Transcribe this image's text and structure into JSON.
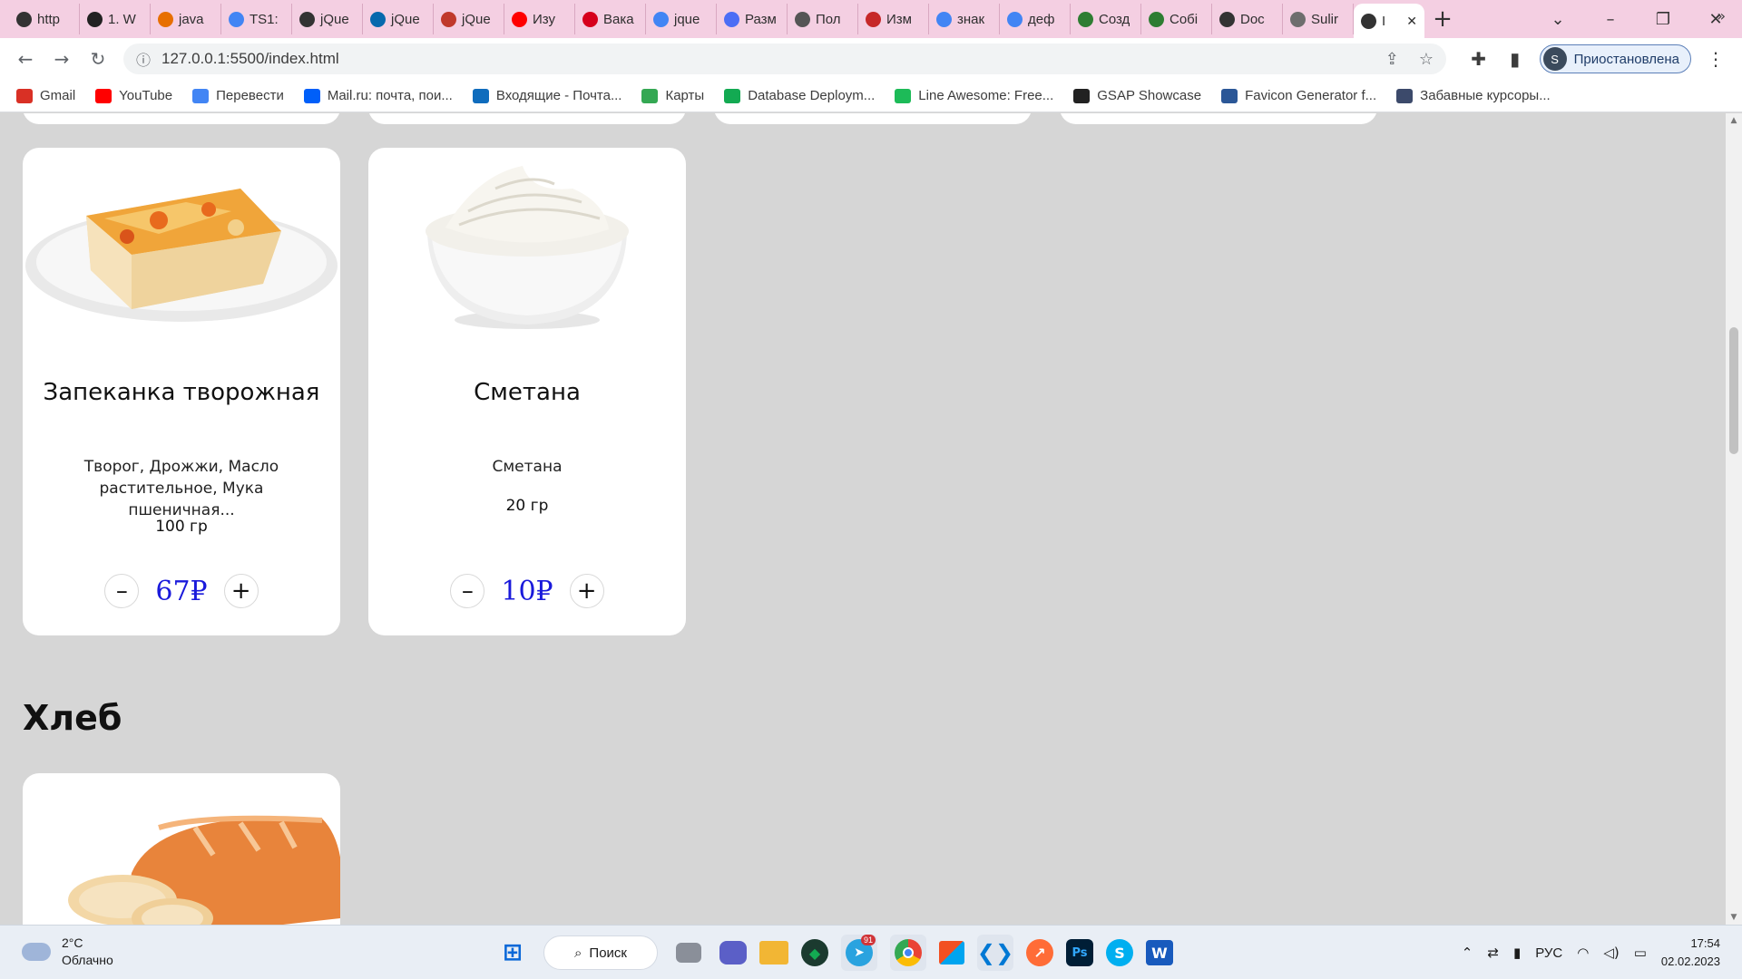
{
  "browser": {
    "tabs": [
      {
        "label": "http",
        "icon": "globe-icon",
        "color": "#333333"
      },
      {
        "label": "1. W",
        "icon": "hacker-icon",
        "color": "#222222"
      },
      {
        "label": "java",
        "icon": "java-icon",
        "color": "#e76f00"
      },
      {
        "label": "TS1:",
        "icon": "google-icon",
        "color": "#4285f4"
      },
      {
        "label": "jQue",
        "icon": "globe-icon",
        "color": "#333333"
      },
      {
        "label": "jQue",
        "icon": "jquery-icon",
        "color": "#0769ad"
      },
      {
        "label": "jQue",
        "icon": "code-icon",
        "color": "#c0392b"
      },
      {
        "label": "Изу",
        "icon": "youtube-icon",
        "color": "#ff0000"
      },
      {
        "label": "Вака",
        "icon": "hh-icon",
        "color": "#d6001c"
      },
      {
        "label": "jque",
        "icon": "google-icon",
        "color": "#4285f4"
      },
      {
        "label": "Разм",
        "icon": "code-icon",
        "color": "#4c6ef5"
      },
      {
        "label": "Пол",
        "icon": "mail-icon",
        "color": "#555555"
      },
      {
        "label": "Изм",
        "icon": "tower-icon",
        "color": "#c62828"
      },
      {
        "label": "знак",
        "icon": "google-icon",
        "color": "#4285f4"
      },
      {
        "label": "деф",
        "icon": "google-icon",
        "color": "#4285f4"
      },
      {
        "label": "Созд",
        "icon": "leaf-icon",
        "color": "#2e7d32"
      },
      {
        "label": "Собі",
        "icon": "leaf-icon",
        "color": "#2e7d32"
      },
      {
        "label": "Doc",
        "icon": "globe-icon",
        "color": "#333333"
      },
      {
        "label": "Sulir",
        "icon": "github-icon",
        "color": "#6e6e6e"
      },
      {
        "label": "I",
        "icon": "globe-icon",
        "color": "#333333",
        "active": true
      }
    ],
    "url": "127.0.0.1:5500/index.html",
    "profile_label": "Приостановлена",
    "profile_initial": "S",
    "bookmarks": [
      {
        "label": "Gmail",
        "icon": "gmail-icon",
        "color": "#d93025"
      },
      {
        "label": "YouTube",
        "icon": "youtube-icon",
        "color": "#ff0000"
      },
      {
        "label": "Перевести",
        "icon": "translate-icon",
        "color": "#4285f4"
      },
      {
        "label": "Mail.ru: почта, пои...",
        "icon": "mailru-icon",
        "color": "#005ff9"
      },
      {
        "label": "Входящие - Почта...",
        "icon": "outlook-icon",
        "color": "#0f6cbd"
      },
      {
        "label": "Карты",
        "icon": "maps-icon",
        "color": "#34a853"
      },
      {
        "label": "Database Deploym...",
        "icon": "mongodb-icon",
        "color": "#13aa52"
      },
      {
        "label": "Line Awesome: Free...",
        "icon": "lineawesome-icon",
        "color": "#1dbb58"
      },
      {
        "label": "GSAP Showcase",
        "icon": "gsap-icon",
        "color": "#222222"
      },
      {
        "label": "Favicon Generator f...",
        "icon": "favicon-icon",
        "color": "#2b5797"
      },
      {
        "label": "Забавные курсоры...",
        "icon": "cursor-icon",
        "color": "#3c4a6b"
      }
    ]
  },
  "page": {
    "products": [
      {
        "name": "Запеканка творожная",
        "description": "Творог, Дрожжи, Масло растительное, Мука пшеничная...",
        "weight": "100 гр",
        "price": "67₽",
        "minus": "–",
        "plus": "+"
      },
      {
        "name": "Сметана",
        "description": "Сметана",
        "weight": "20 гр",
        "price": "10₽",
        "minus": "–",
        "plus": "+"
      }
    ],
    "section_title": "Хлеб"
  },
  "taskbar": {
    "weather_temp": "2°C",
    "weather_desc": "Облачно",
    "search_label": "Поиск",
    "telegram_badge": "91",
    "language": "РУС",
    "time": "17:54",
    "date": "02.02.2023"
  },
  "colors": {
    "price": "#1a1adb",
    "tabstrip": "#f4cfe2",
    "page_bg": "#d6d6d6"
  }
}
